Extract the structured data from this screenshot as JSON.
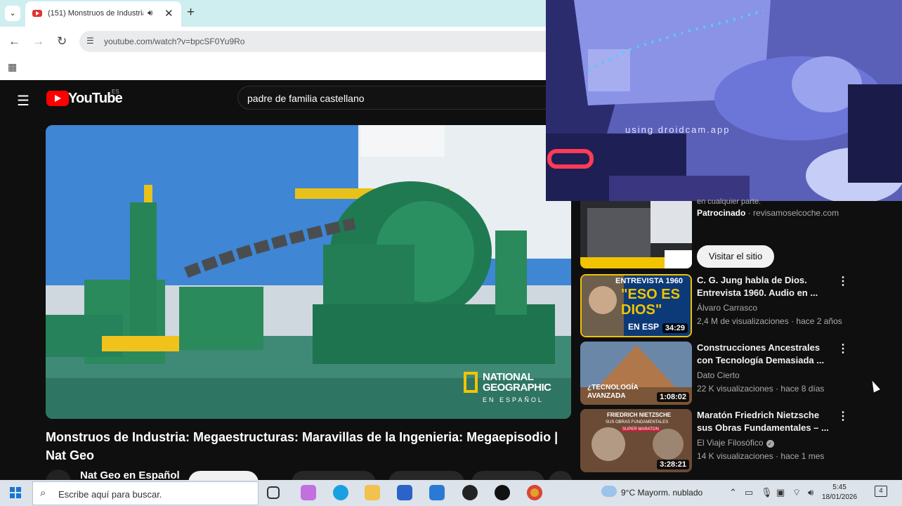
{
  "browser": {
    "tab_title": "(151) Monstruos de Industria",
    "tab_audio_icon": "speaker-icon",
    "url": "youtube.com/watch?v=bpcSF0Yu9Ro"
  },
  "youtube": {
    "logo_text": "YouTube",
    "region": "ES",
    "search_value": "padre de familia castellano",
    "video": {
      "overlay_brand_line1": "NATIONAL",
      "overlay_brand_line2": "GEOGRAPHIC",
      "overlay_brand_sub": "EN ESPAÑOL",
      "title": "Monstruos de Industria: Megaestructuras: Maravillas de la Ingenieria: Megaepisodio | Nat Geo",
      "channel": "Nat Geo en Español"
    },
    "webcam_label": "using droidcam.app",
    "ad": {
      "partial_text": "en cualquier parte.",
      "sponsored_label": "Patrocinado",
      "sponsor_domain": "revisamoselcoche.com",
      "visit_button": "Visitar el sitio"
    },
    "recommendations": [
      {
        "title": "C. G. Jung habla de Dios. Entrevista 1960.  Audio en ...",
        "channel": "Álvaro Carrasco",
        "meta": "2,4 M de visualizaciones · hace 2 años",
        "duration": "34:29",
        "thumb_line1": "ENTREVISTA 1960",
        "thumb_line2": "\"ESO ES",
        "thumb_line3": "DIOS\"",
        "thumb_line4": "EN ESP"
      },
      {
        "title": "Construcciones Ancestrales con Tecnología Demasiada ...",
        "channel": "Dato Cierto",
        "meta": "22 K visualizaciones · hace 8 días",
        "duration": "1:08:02",
        "thumb_line1": "¿TECNOLOGÍA",
        "thumb_line2": "AVANZADA"
      },
      {
        "title": "Maratón Friedrich Nietzsche sus Obras Fundamentales – ...",
        "channel": "El Viaje Filosófico",
        "meta": "14 K visualizaciones · hace 1 mes",
        "duration": "3:28:21",
        "thumb_line1": "FRIEDRICH NIETZSCHE",
        "thumb_line2": "SUS OBRAS FUNDAMENTALES",
        "thumb_line3": "SUPER MARATON"
      }
    ]
  },
  "taskbar": {
    "search_placeholder": "Escribe aquí para buscar.",
    "weather": "9°C  Mayorm. nublado",
    "time": "5:45",
    "date": "18/01/2026",
    "notification_count": "4"
  }
}
